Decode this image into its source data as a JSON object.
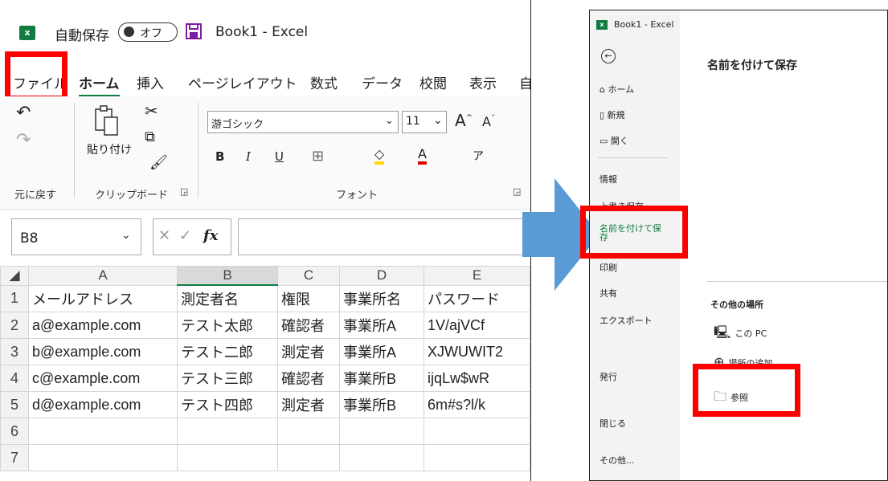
{
  "left": {
    "title": {
      "logo": "x",
      "autosave_label": "自動保存",
      "toggle_text": "オフ",
      "save_icon": "save-icon",
      "book_title": "Book1 - Excel"
    },
    "menu": [
      "ファイル",
      "ホーム",
      "挿入",
      "ページレイアウト",
      "数式",
      "データ",
      "校閲",
      "表示",
      "自"
    ],
    "ribbon": {
      "undo_group_label": "元に戻す",
      "paste_label": "貼り付け",
      "clipboard_label": "クリップボード",
      "font_name": "游ゴシック",
      "font_size": "11",
      "font_group_label": "フォント",
      "bold": "B",
      "italic": "I",
      "underline": "U"
    },
    "formula_bar": {
      "name_box": "B8",
      "fx_label": "fx"
    },
    "sheet": {
      "columns": [
        "A",
        "B",
        "C",
        "D",
        "E"
      ],
      "rows": [
        [
          "メールアドレス",
          "測定者名",
          "権限",
          "事業所名",
          "パスワード"
        ],
        [
          "a@example.com",
          "テスト太郎",
          "確認者",
          "事業所A",
          "1V/ajVCf"
        ],
        [
          "b@example.com",
          "テスト二郎",
          "測定者",
          "事業所A",
          "XJWUWIT2"
        ],
        [
          "c@example.com",
          "テスト三郎",
          "確認者",
          "事業所B",
          "ijqLw$wR"
        ],
        [
          "d@example.com",
          "テスト四郎",
          "測定者",
          "事業所B",
          "6m#s?l/k"
        ],
        [
          "",
          "",
          "",
          "",
          ""
        ],
        [
          "",
          "",
          "",
          "",
          ""
        ]
      ],
      "row_numbers": [
        "1",
        "2",
        "3",
        "4",
        "5",
        "6",
        "7"
      ]
    }
  },
  "right": {
    "title": "Book1 - Excel",
    "nav": [
      "ホーム",
      "新規",
      "開く",
      "情報",
      "上書き保存",
      "名前を付けて保存",
      "印刷",
      "共有",
      "エクスポート",
      "発行",
      "閉じる",
      "その他..."
    ],
    "heading": "名前を付けて保存",
    "other_places": "その他の場所",
    "locations": [
      "この PC",
      "場所の追加",
      "参照"
    ]
  },
  "colors": {
    "highlight": "#ff0000",
    "excel_green": "#107c41",
    "arrow": "#5b9bd5"
  }
}
